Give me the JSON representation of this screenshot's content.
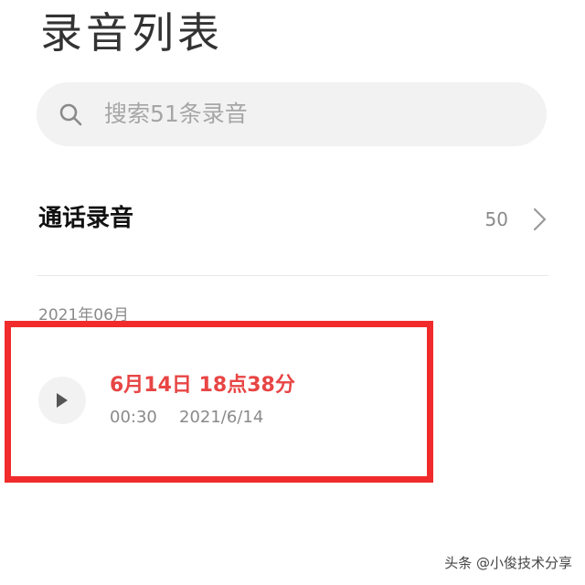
{
  "header": {
    "title": "录音列表"
  },
  "search": {
    "placeholder": "搜索51条录音",
    "icon": "search-icon"
  },
  "call_recordings": {
    "label": "通话录音",
    "count": "50",
    "icon": "chevron-right-icon"
  },
  "recordings": {
    "month_header": "2021年06月",
    "items": [
      {
        "title": "6月14日 18点38分",
        "duration": "00:30",
        "date": "2021/6/14",
        "icon": "play-icon"
      }
    ]
  },
  "watermark": {
    "text": "头条 @小俊技术分享"
  },
  "colors": {
    "title_red": "#e84545",
    "highlight_border": "#f12b2b",
    "search_bg": "#f2f2f2"
  }
}
